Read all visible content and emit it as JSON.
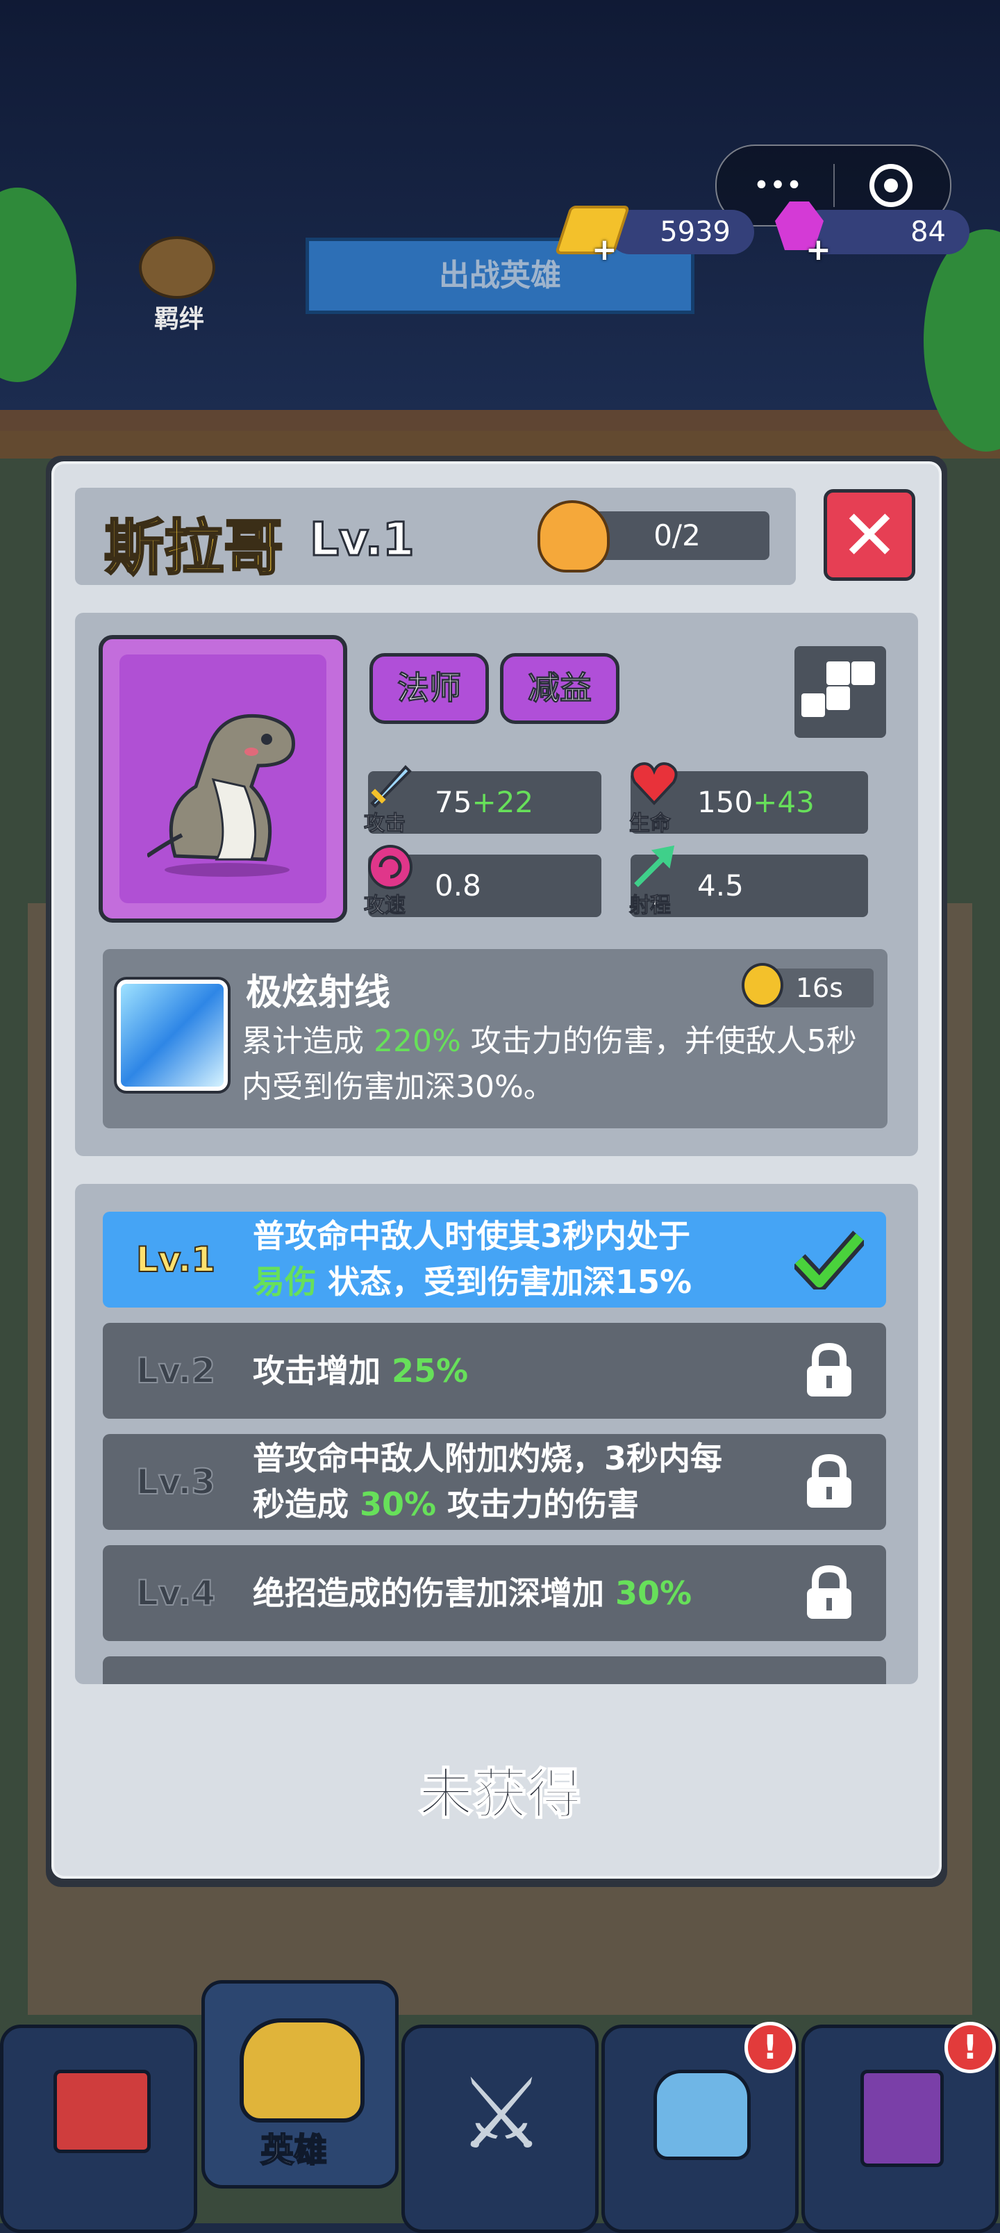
{
  "currency": {
    "gold": "5939",
    "gems": "84"
  },
  "capsule": {
    "more_label": "•••"
  },
  "background": {
    "banner": "出战英雄",
    "bond_label": "羁绊"
  },
  "hero": {
    "name": "斯拉哥",
    "level": "Lv.1",
    "fragments": "0/2",
    "tags": [
      "法师",
      "减益"
    ],
    "stats": {
      "attack_label": "攻击",
      "attack_base": "75",
      "attack_bonus": "+22",
      "hp_label": "生命",
      "hp_base": "150",
      "hp_bonus": "+43",
      "speed_label": "攻速",
      "speed_value": "0.8",
      "range_label": "射程",
      "range_value": "4.5"
    }
  },
  "skill": {
    "name": "极炫射线",
    "cooldown": "16s",
    "desc_a": "累计造成 ",
    "desc_hl": "220%",
    "desc_b": " 攻击力的伤害，并使敌人5秒内受到伤害加深30%。"
  },
  "levels": [
    {
      "label": "Lv.1",
      "line1": "普攻命中敌人时使其3秒内处于",
      "hl": "易伤",
      "line2": " 状态，受到伤害加深15%"
    },
    {
      "label": "Lv.2",
      "text": "攻击增加 ",
      "hl": "25%"
    },
    {
      "label": "Lv.3",
      "line1": "普攻命中敌人附加灼烧，3秒内每",
      "line2a": "秒造成 ",
      "hl": "30%",
      "line2b": " 攻击力的伤害"
    },
    {
      "label": "Lv.4",
      "text": "绝招造成的伤害加深增加 ",
      "hl": "30%"
    }
  ],
  "status": "未获得",
  "nav": {
    "hero_label": "英雄",
    "badge": "!"
  },
  "colors": {
    "highlight": "#67e05a",
    "active_row": "#45a4f5",
    "tag": "#b04fd8",
    "close": "#e63f54"
  }
}
